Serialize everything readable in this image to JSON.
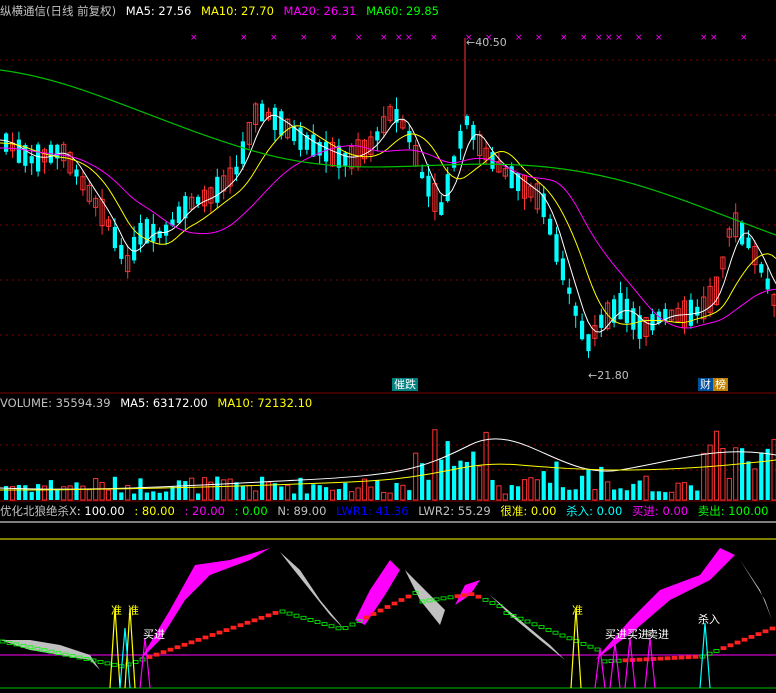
{
  "price_header": {
    "title": "纵横通信(日线 前复权)",
    "ma5": "MA5: 27.56",
    "ma10": "MA10: 27.70",
    "ma20": "MA20: 26.31",
    "ma60": "MA60: 29.85"
  },
  "price_annotations": {
    "high": "40.50",
    "low": "21.80"
  },
  "event_tags": {
    "tag1": "催跌",
    "tag2a": "财",
    "tag2b": "榜"
  },
  "volume_header": {
    "volume": "VOLUME: 35594.39",
    "ma5": "MA5: 63172.00",
    "ma10": "MA10: 72132.10"
  },
  "indicator_header": {
    "name": "优化北狼绝杀X",
    "v1": ": 100.00",
    "v2": ": 80.00",
    "v3": ": 20.00",
    "v4": ": 0.00",
    "n": "N: 89.00",
    "lwr1": "LWR1: 41.36",
    "lwr2": "LWR2: 55.29",
    "zhun": "很准: 0.00",
    "sharu": "杀入: 0.00",
    "mai_jin": "买进: 0.00",
    "mai_chu": "卖出: 100.00"
  },
  "indicator_labels": {
    "zhun1": "准",
    "zhun2": "准",
    "zhun3": "准",
    "buy1": "买进",
    "buy2": "买进",
    "buy3": "买进",
    "buy4": "卖进",
    "sharu": "杀入"
  },
  "colors": {
    "up": "#ff3232",
    "down": "#00ffff",
    "ma5": "#ffffff",
    "ma10": "#ffff00",
    "ma20": "#ff00ff",
    "ma60": "#00c000",
    "grid": "#800000"
  }
}
